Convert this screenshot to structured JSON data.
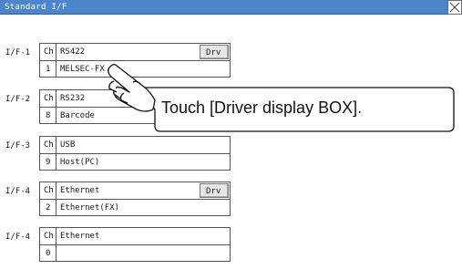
{
  "window": {
    "title": "Standard I/F",
    "close_icon": "close-x-icon"
  },
  "interfaces": [
    {
      "label": "I/F-1",
      "ch_header": "Ch",
      "driver": "RS422",
      "channel": "1",
      "device": "MELSEC-FX",
      "drv_button": "Drv"
    },
    {
      "label": "I/F-2",
      "ch_header": "Ch",
      "driver": "RS232",
      "channel": "8",
      "device": "Barcode",
      "drv_button": ""
    },
    {
      "label": "I/F-3",
      "ch_header": "Ch",
      "driver": "USB",
      "channel": "9",
      "device": "Host(PC)",
      "drv_button": ""
    },
    {
      "label": "I/F-4",
      "ch_header": "Ch",
      "driver": "Ethernet",
      "channel": "2",
      "device": "Ethernet(FX)",
      "drv_button": "Drv"
    },
    {
      "label": "I/F-4",
      "ch_header": "Ch",
      "driver": "Ethernet",
      "channel": "0",
      "device": "",
      "drv_button": ""
    }
  ],
  "annotation": {
    "text": "Touch [Driver display BOX].",
    "icon": "pointing-hand-icon"
  },
  "colors": {
    "titlebar": "#4b86cc",
    "border": "#555555",
    "drv_button": "#e6e6e6"
  }
}
